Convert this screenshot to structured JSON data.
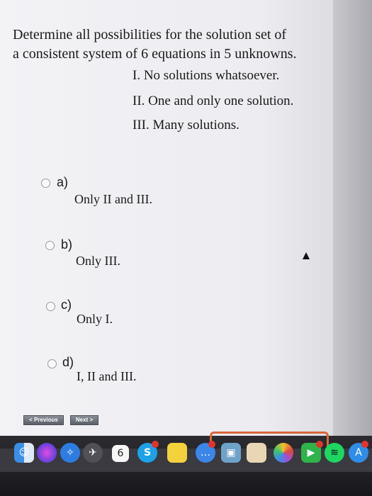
{
  "question": {
    "line1": "Determine all possibilities for the solution set of",
    "line2": "a consistent system of 6 equations in 5 unknowns.",
    "options": [
      "I. No solutions whatsoever.",
      "II. One and only one solution.",
      "III. Many solutions."
    ]
  },
  "answers": [
    {
      "letter": "a)",
      "text": "Only II and III."
    },
    {
      "letter": "b)",
      "text": "Only III."
    },
    {
      "letter": "c)",
      "text": "Only I."
    },
    {
      "letter": "d)",
      "text": "I, II and III."
    }
  ],
  "nav": {
    "previous_label": "< Previous",
    "next_label": "Next >"
  },
  "dock": {
    "calendar_day": "6",
    "icons": [
      "finder-icon",
      "siri-icon",
      "safari-icon",
      "launchpad-icon",
      "calendar-icon",
      "skype-icon",
      "notes-icon",
      "messages-icon",
      "preview-icon",
      "books-icon",
      "photos-icon",
      "facetime-icon",
      "spotify-icon",
      "app-store-icon"
    ]
  }
}
